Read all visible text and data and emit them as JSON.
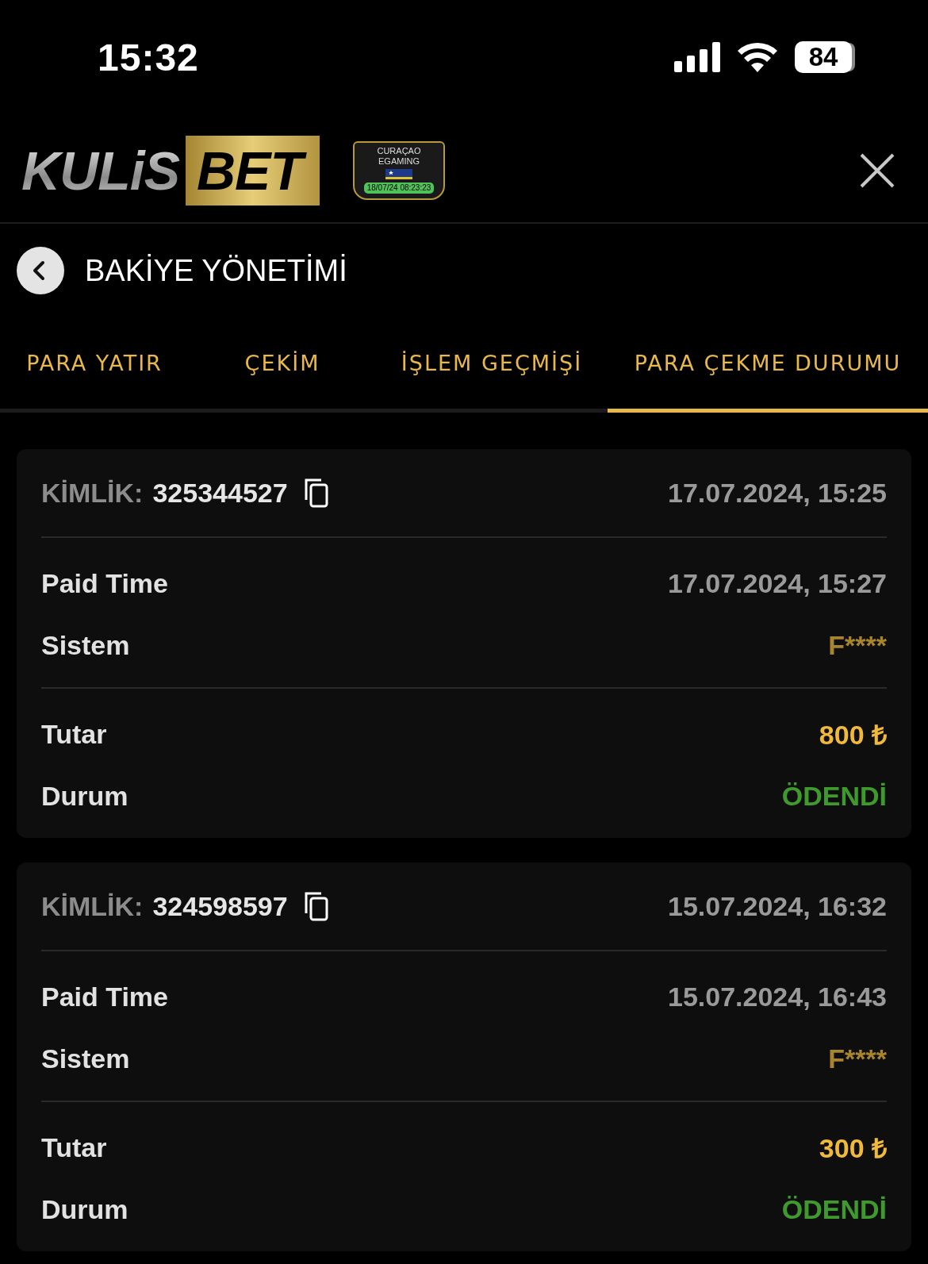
{
  "status_bar": {
    "time": "15:32",
    "battery": "84"
  },
  "header": {
    "logo": {
      "part_1": "KULiS",
      "part_2": "BET"
    },
    "badge": {
      "line_1": "CURAÇAO",
      "line_2": "EGAMING",
      "stamp": "18/07/24 08:23:23"
    }
  },
  "page_title": "BAKİYE YÖNETİMİ",
  "tabs": [
    {
      "label": "PARA YATIR",
      "selected": false
    },
    {
      "label": "ÇEKİM",
      "selected": false
    },
    {
      "label": "İŞLEM GEÇMİŞİ",
      "selected": false
    },
    {
      "label": "PARA ÇEKME DURUMU",
      "selected": true
    }
  ],
  "withdrawals": [
    {
      "id_label": "KİMLİK:",
      "id": "325344527",
      "date": "17.07.2024, 15:25",
      "groups": [
        [
          {
            "label": "Paid Time",
            "value": "17.07.2024, 15:27",
            "kind": "time"
          },
          {
            "label": "Sistem",
            "value": "F****",
            "kind": "system"
          }
        ],
        [
          {
            "label": "Tutar",
            "value": "800 ₺",
            "kind": "amount"
          },
          {
            "label": "Durum",
            "value": "ÖDENDİ",
            "kind": "status"
          }
        ]
      ]
    },
    {
      "id_label": "KİMLİK:",
      "id": "324598597",
      "date": "15.07.2024, 16:32",
      "groups": [
        [
          {
            "label": "Paid Time",
            "value": "15.07.2024, 16:43",
            "kind": "time"
          },
          {
            "label": "Sistem",
            "value": "F****",
            "kind": "system"
          }
        ],
        [
          {
            "label": "Tutar",
            "value": "300 ₺",
            "kind": "amount"
          },
          {
            "label": "Durum",
            "value": "ÖDENDİ",
            "kind": "status"
          }
        ]
      ]
    }
  ]
}
